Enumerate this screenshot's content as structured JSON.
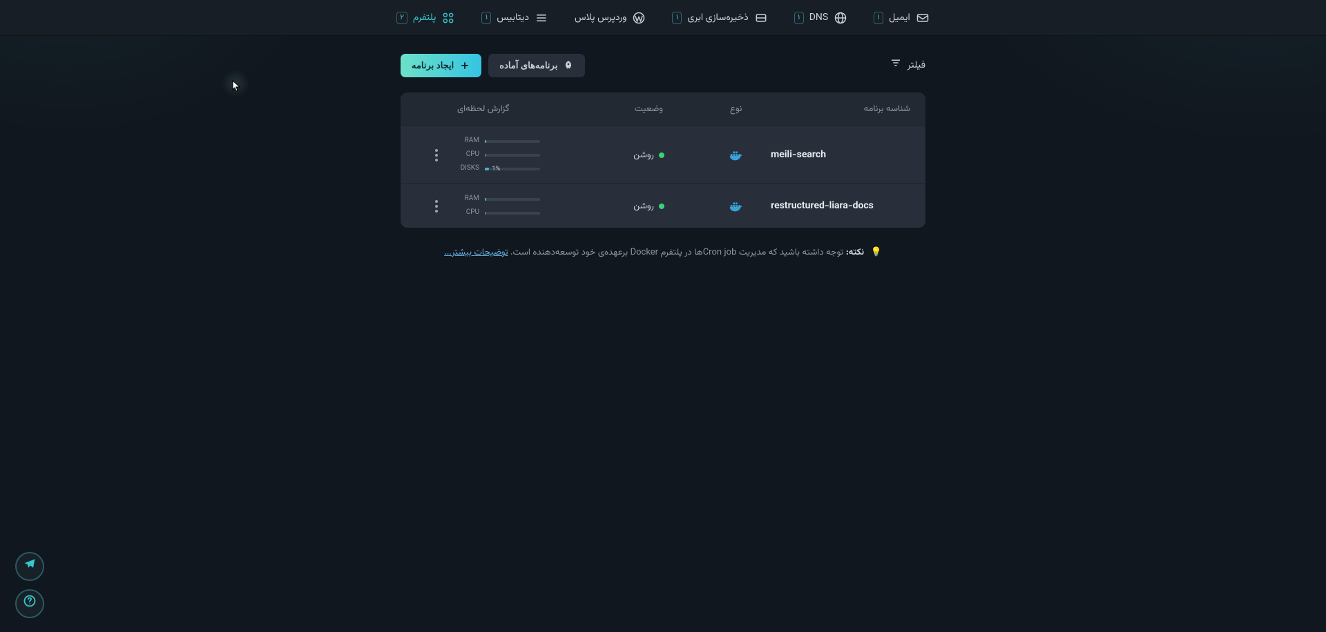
{
  "nav": {
    "items": [
      {
        "key": "platform",
        "label": "پلتفرم",
        "badge": "۲",
        "icon": "platform"
      },
      {
        "key": "database",
        "label": "دیتابیس",
        "badge": "۱",
        "icon": "database"
      },
      {
        "key": "wordpress",
        "label": "وردپرس پلاس",
        "badge": "",
        "icon": "wordpress"
      },
      {
        "key": "storage",
        "label": "ذخیره‌سازی ابری",
        "badge": "۱",
        "icon": "storage"
      },
      {
        "key": "dns",
        "label": "DNS",
        "badge": "۱",
        "icon": "dns"
      },
      {
        "key": "mail",
        "label": "ایمیل",
        "badge": "۱",
        "icon": "mail"
      }
    ]
  },
  "actions": {
    "create_app": "ایجاد برنامه",
    "one_click": "برنامه‌های آماده",
    "filter": "فیلتر"
  },
  "table": {
    "headers": {
      "id": "شناسه برنامه",
      "type": "نوع",
      "status": "وضعیت",
      "report": "گزارش لحظه‌ای"
    },
    "rows": [
      {
        "id": "meili-search",
        "type": "docker",
        "status": "روشن",
        "metrics": [
          {
            "label": "RAM",
            "percent": 2,
            "value": ""
          },
          {
            "label": "CPU",
            "percent": 1,
            "value": ""
          },
          {
            "label": "DISKS",
            "percent": 8,
            "value": "1%"
          }
        ]
      },
      {
        "id": "restructured-liara-docs",
        "type": "docker",
        "status": "روشن",
        "metrics": [
          {
            "label": "RAM",
            "percent": 3,
            "value": ""
          },
          {
            "label": "CPU",
            "percent": 1,
            "value": ""
          }
        ]
      }
    ]
  },
  "note": {
    "emoji": "💡",
    "label": "نکته:",
    "text": "توجه داشته باشید که مدیریت Cron jobها در پلتفرم Docker برعهده‌ی خود توسعه‌دهنده است.",
    "more": "توضیحات بیشتر..."
  }
}
